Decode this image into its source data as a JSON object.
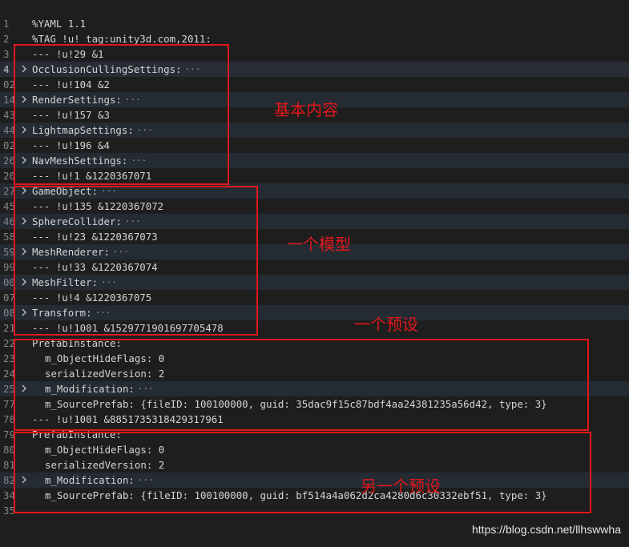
{
  "lines": [
    {
      "n": "1",
      "text": "%YAML 1.1",
      "fold": false,
      "indent": 0,
      "collapsed": false,
      "alt": false
    },
    {
      "n": "2",
      "text": "%TAG !u! tag:unity3d.com,2011:",
      "fold": false,
      "indent": 0,
      "collapsed": false,
      "alt": false
    },
    {
      "n": "3",
      "text": "--- !u!29 &1",
      "fold": false,
      "indent": 0,
      "collapsed": false,
      "alt": false
    },
    {
      "n": "4",
      "text": "OcclusionCullingSettings:",
      "fold": true,
      "indent": 0,
      "collapsed": true,
      "alt": true,
      "current": true
    },
    {
      "n": "02",
      "text": "--- !u!104 &2",
      "fold": false,
      "indent": 0,
      "collapsed": false,
      "alt": false
    },
    {
      "n": "14",
      "text": "RenderSettings:",
      "fold": true,
      "indent": 0,
      "collapsed": true,
      "alt": true
    },
    {
      "n": "43",
      "text": "--- !u!157 &3",
      "fold": false,
      "indent": 0,
      "collapsed": false,
      "alt": false
    },
    {
      "n": "44",
      "text": "LightmapSettings:",
      "fold": true,
      "indent": 0,
      "collapsed": true,
      "alt": true
    },
    {
      "n": "02",
      "text": "--- !u!196 &4",
      "fold": false,
      "indent": 0,
      "collapsed": false,
      "alt": false
    },
    {
      "n": "26",
      "text": "NavMeshSettings:",
      "fold": true,
      "indent": 0,
      "collapsed": true,
      "alt": true
    },
    {
      "n": "20",
      "text": "--- !u!1 &1220367071",
      "fold": false,
      "indent": 0,
      "collapsed": false,
      "alt": false
    },
    {
      "n": "27",
      "text": "GameObject:",
      "fold": true,
      "indent": 0,
      "collapsed": true,
      "alt": true
    },
    {
      "n": "45",
      "text": "--- !u!135 &1220367072",
      "fold": false,
      "indent": 0,
      "collapsed": false,
      "alt": false
    },
    {
      "n": "46",
      "text": "SphereCollider:",
      "fold": true,
      "indent": 0,
      "collapsed": true,
      "alt": true
    },
    {
      "n": "58",
      "text": "--- !u!23 &1220367073",
      "fold": false,
      "indent": 0,
      "collapsed": false,
      "alt": false
    },
    {
      "n": "59",
      "text": "MeshRenderer:",
      "fold": true,
      "indent": 0,
      "collapsed": true,
      "alt": true
    },
    {
      "n": "99",
      "text": "--- !u!33 &1220367074",
      "fold": false,
      "indent": 0,
      "collapsed": false,
      "alt": false
    },
    {
      "n": "00",
      "text": "MeshFilter:",
      "fold": true,
      "indent": 0,
      "collapsed": true,
      "alt": true
    },
    {
      "n": "07",
      "text": "--- !u!4 &1220367075",
      "fold": false,
      "indent": 0,
      "collapsed": false,
      "alt": false
    },
    {
      "n": "08",
      "text": "Transform:",
      "fold": true,
      "indent": 0,
      "collapsed": true,
      "alt": true
    },
    {
      "n": "21",
      "text": "--- !u!1001 &1529771901697705478",
      "fold": false,
      "indent": 0,
      "collapsed": false,
      "alt": false
    },
    {
      "n": "22",
      "text": "PrefabInstance:",
      "fold": false,
      "indent": 0,
      "collapsed": false,
      "alt": false
    },
    {
      "n": "23",
      "text": "m_ObjectHideFlags: 0",
      "fold": false,
      "indent": 1,
      "collapsed": false,
      "alt": false
    },
    {
      "n": "24",
      "text": "serializedVersion: 2",
      "fold": false,
      "indent": 1,
      "collapsed": false,
      "alt": false
    },
    {
      "n": "25",
      "text": "m_Modification:",
      "fold": true,
      "indent": 1,
      "collapsed": true,
      "alt": true
    },
    {
      "n": "77",
      "text": "m_SourcePrefab: {fileID: 100100000, guid: 35dac9f15c87bdf4aa24381235a56d42, type: 3}",
      "fold": false,
      "indent": 1,
      "collapsed": false,
      "alt": false
    },
    {
      "n": "78",
      "text": "--- !u!1001 &8851735318429317961",
      "fold": false,
      "indent": 0,
      "collapsed": false,
      "alt": false
    },
    {
      "n": "79",
      "text": "PrefabInstance:",
      "fold": false,
      "indent": 0,
      "collapsed": false,
      "alt": false
    },
    {
      "n": "80",
      "text": "m_ObjectHideFlags: 0",
      "fold": false,
      "indent": 1,
      "collapsed": false,
      "alt": false
    },
    {
      "n": "81",
      "text": "serializedVersion: 2",
      "fold": false,
      "indent": 1,
      "collapsed": false,
      "alt": false
    },
    {
      "n": "82",
      "text": "m_Modification:",
      "fold": true,
      "indent": 1,
      "collapsed": true,
      "alt": true
    },
    {
      "n": "34",
      "text": "m_SourcePrefab: {fileID: 100100000, guid: bf514a4a062d2ca4280d6c30332ebf51, type: 3}",
      "fold": false,
      "indent": 1,
      "collapsed": false,
      "alt": false
    },
    {
      "n": "35",
      "text": "",
      "fold": false,
      "indent": 0,
      "collapsed": false,
      "alt": false
    }
  ],
  "annotations": {
    "basic_content": "基本内容",
    "one_model": "一个模型",
    "one_prefab": "一个预设",
    "another_prefab": "另一个预设"
  },
  "fold_glyph": "chevron-right-icon",
  "ellipsis": "···",
  "watermark": "https://blog.csdn.net/llhswwha",
  "colors": {
    "annotation": "#e0181b",
    "background": "#1e1e1e",
    "text": "#d4d4d4"
  }
}
